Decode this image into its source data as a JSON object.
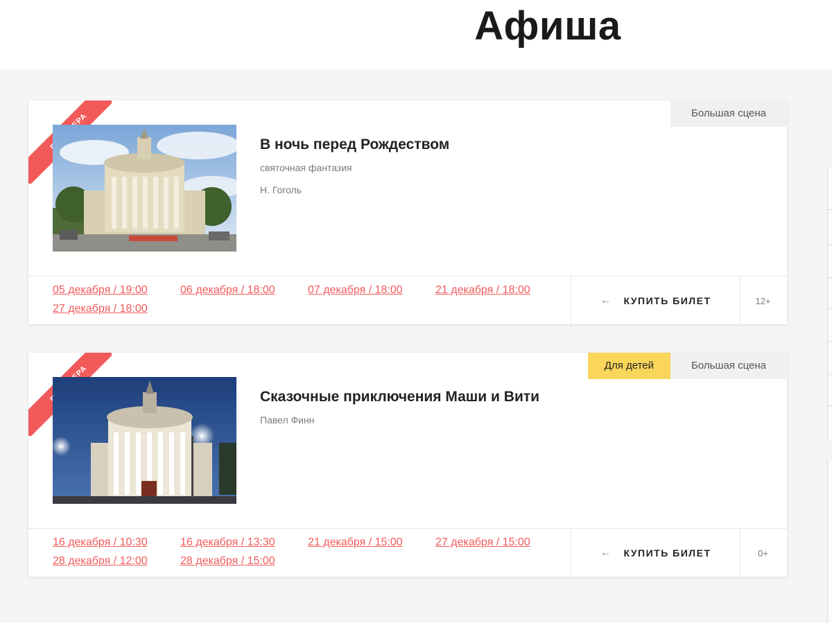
{
  "header": {
    "title": "Афиша"
  },
  "events": [
    {
      "ribbon": "ПРЕМЬЕРА",
      "title": "В ночь перед Рождеством",
      "genre": "святочная фантазия",
      "author": "Н. Гоголь",
      "tags": [
        "Большая сцена"
      ],
      "dates": [
        "05 декабря / 19:00",
        "06 декабря / 18:00",
        "07 декабря / 18:00",
        "21 декабря / 18:00",
        "27 декабря / 18:00"
      ],
      "buy_label": "КУПИТЬ БИЛЕТ",
      "age": "12+"
    },
    {
      "ribbon": "ПРЕМЬЕРА",
      "title": "Сказочные приключения Маши и Вити",
      "author": "Павел Финн",
      "tags": [
        "Для детей",
        "Большая сцена"
      ],
      "dates": [
        "16 декабря / 10:30",
        "16 декабря / 13:30",
        "21 декабря / 15:00",
        "27 декабря / 15:00",
        "28 декабря / 12:00",
        "28 декабря / 15:00"
      ],
      "buy_label": "КУПИТЬ БИЛЕТ",
      "age": "0+"
    }
  ],
  "icons": {
    "buy": "arrow-left-icon"
  },
  "colors": {
    "accent": "#f25a5a",
    "kids_tag": "#f9d55a",
    "tag_bg": "#f0f0f0"
  }
}
